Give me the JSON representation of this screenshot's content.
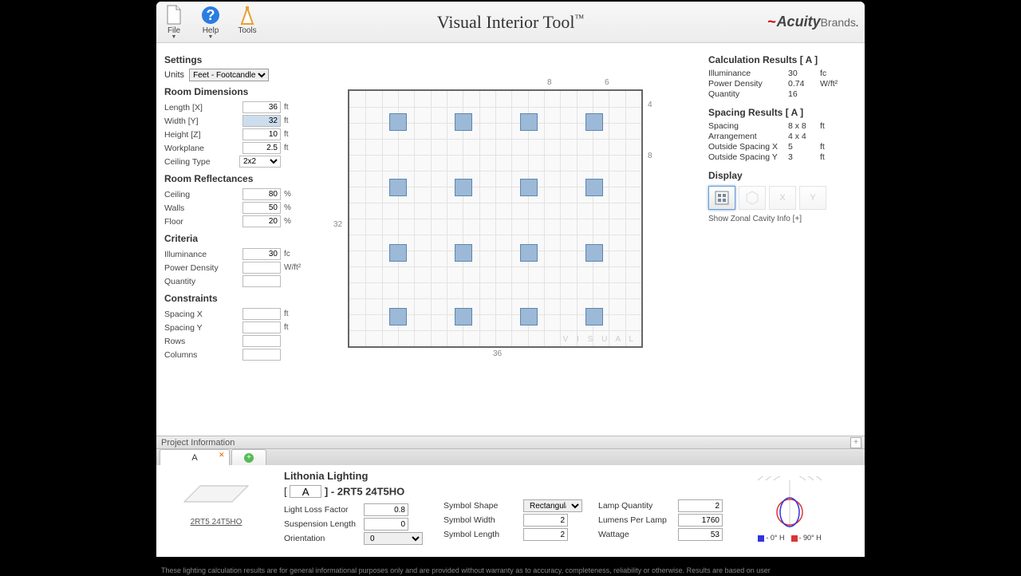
{
  "title": "Visual Interior Tool",
  "brand": {
    "swoosh": "~",
    "name": "Acuity",
    "sub": "Brands"
  },
  "toolbar": {
    "file": "File",
    "help": "Help",
    "tools": "Tools"
  },
  "settings": {
    "header": "Settings",
    "units_label": "Units",
    "units_value": "Feet - Footcandles"
  },
  "room_dimensions": {
    "header": "Room Dimensions",
    "rows": [
      {
        "label": "Length [X]",
        "value": "36",
        "unit": "ft"
      },
      {
        "label": "Width [Y]",
        "value": "32",
        "unit": "ft",
        "selected": true
      },
      {
        "label": "Height [Z]",
        "value": "10",
        "unit": "ft"
      },
      {
        "label": "Workplane",
        "value": "2.5",
        "unit": "ft"
      }
    ],
    "ceiling_label": "Ceiling Type",
    "ceiling_value": "2x2"
  },
  "reflectances": {
    "header": "Room Reflectances",
    "rows": [
      {
        "label": "Ceiling",
        "value": "80",
        "unit": "%"
      },
      {
        "label": "Walls",
        "value": "50",
        "unit": "%"
      },
      {
        "label": "Floor",
        "value": "20",
        "unit": "%"
      }
    ]
  },
  "criteria": {
    "header": "Criteria",
    "rows": [
      {
        "label": "Illuminance",
        "value": "30",
        "unit": "fc"
      },
      {
        "label": "Power Density",
        "value": "",
        "unit": "W/ft²"
      },
      {
        "label": "Quantity",
        "value": "",
        "unit": ""
      }
    ]
  },
  "constraints": {
    "header": "Constraints",
    "rows": [
      {
        "label": "Spacing X",
        "value": "",
        "unit": "ft"
      },
      {
        "label": "Spacing Y",
        "value": "",
        "unit": "ft"
      },
      {
        "label": "Rows",
        "value": "",
        "unit": ""
      },
      {
        "label": "Columns",
        "value": "",
        "unit": ""
      }
    ]
  },
  "canvas": {
    "left_dim": "32",
    "bottom_dim": "36",
    "top_dim_a": "8",
    "top_dim_b": "6",
    "right_dim_a": "4",
    "right_dim_b": "8",
    "watermark": "V I S U A L"
  },
  "calc_results": {
    "header": "Calculation Results   [ A ]",
    "rows": [
      {
        "label": "Illuminance",
        "value": "30",
        "unit": "fc"
      },
      {
        "label": "Power Density",
        "value": "0.74",
        "unit": "W/ft²"
      },
      {
        "label": "Quantity",
        "value": "16",
        "unit": ""
      }
    ]
  },
  "spacing_results": {
    "header": "Spacing Results   [ A ]",
    "rows": [
      {
        "label": "Spacing",
        "value": "8 x 8",
        "unit": "ft"
      },
      {
        "label": "Arrangement",
        "value": "4 x 4",
        "unit": ""
      },
      {
        "label": "Outside Spacing X",
        "value": "5",
        "unit": "ft"
      },
      {
        "label": "Outside Spacing Y",
        "value": "3",
        "unit": "ft"
      }
    ]
  },
  "display": {
    "header": "Display",
    "zonal": "Show Zonal Cavity Info [+]"
  },
  "project_bar": "Project Information",
  "tab_label": "A",
  "fixture": {
    "brand": "Lithonia Lighting",
    "code_prefix": "[",
    "code_input": "A",
    "code_suffix": "] - 2RT5 24T5HO",
    "link": "2RT5 24T5HO",
    "col1": [
      {
        "label": "Light Loss Factor",
        "value": "0.8"
      },
      {
        "label": "Suspension Length",
        "value": "0"
      },
      {
        "label": "Orientation",
        "value": "0",
        "select": true
      }
    ],
    "col2": [
      {
        "label": "Symbol Shape",
        "value": "Rectangular",
        "select": true
      },
      {
        "label": "Symbol Width",
        "value": "2"
      },
      {
        "label": "Symbol Length",
        "value": "2"
      }
    ],
    "col3": [
      {
        "label": "Lamp Quantity",
        "value": "2"
      },
      {
        "label": "Lumens Per Lamp",
        "value": "1760"
      },
      {
        "label": "Wattage",
        "value": "53"
      }
    ],
    "legend_a": "- 0° H",
    "legend_b": "- 90° H"
  },
  "footer": "These lighting calculation results are for general informational purposes only and are provided without warranty as to accuracy, completeness, reliability or otherwise. Results are based on user"
}
